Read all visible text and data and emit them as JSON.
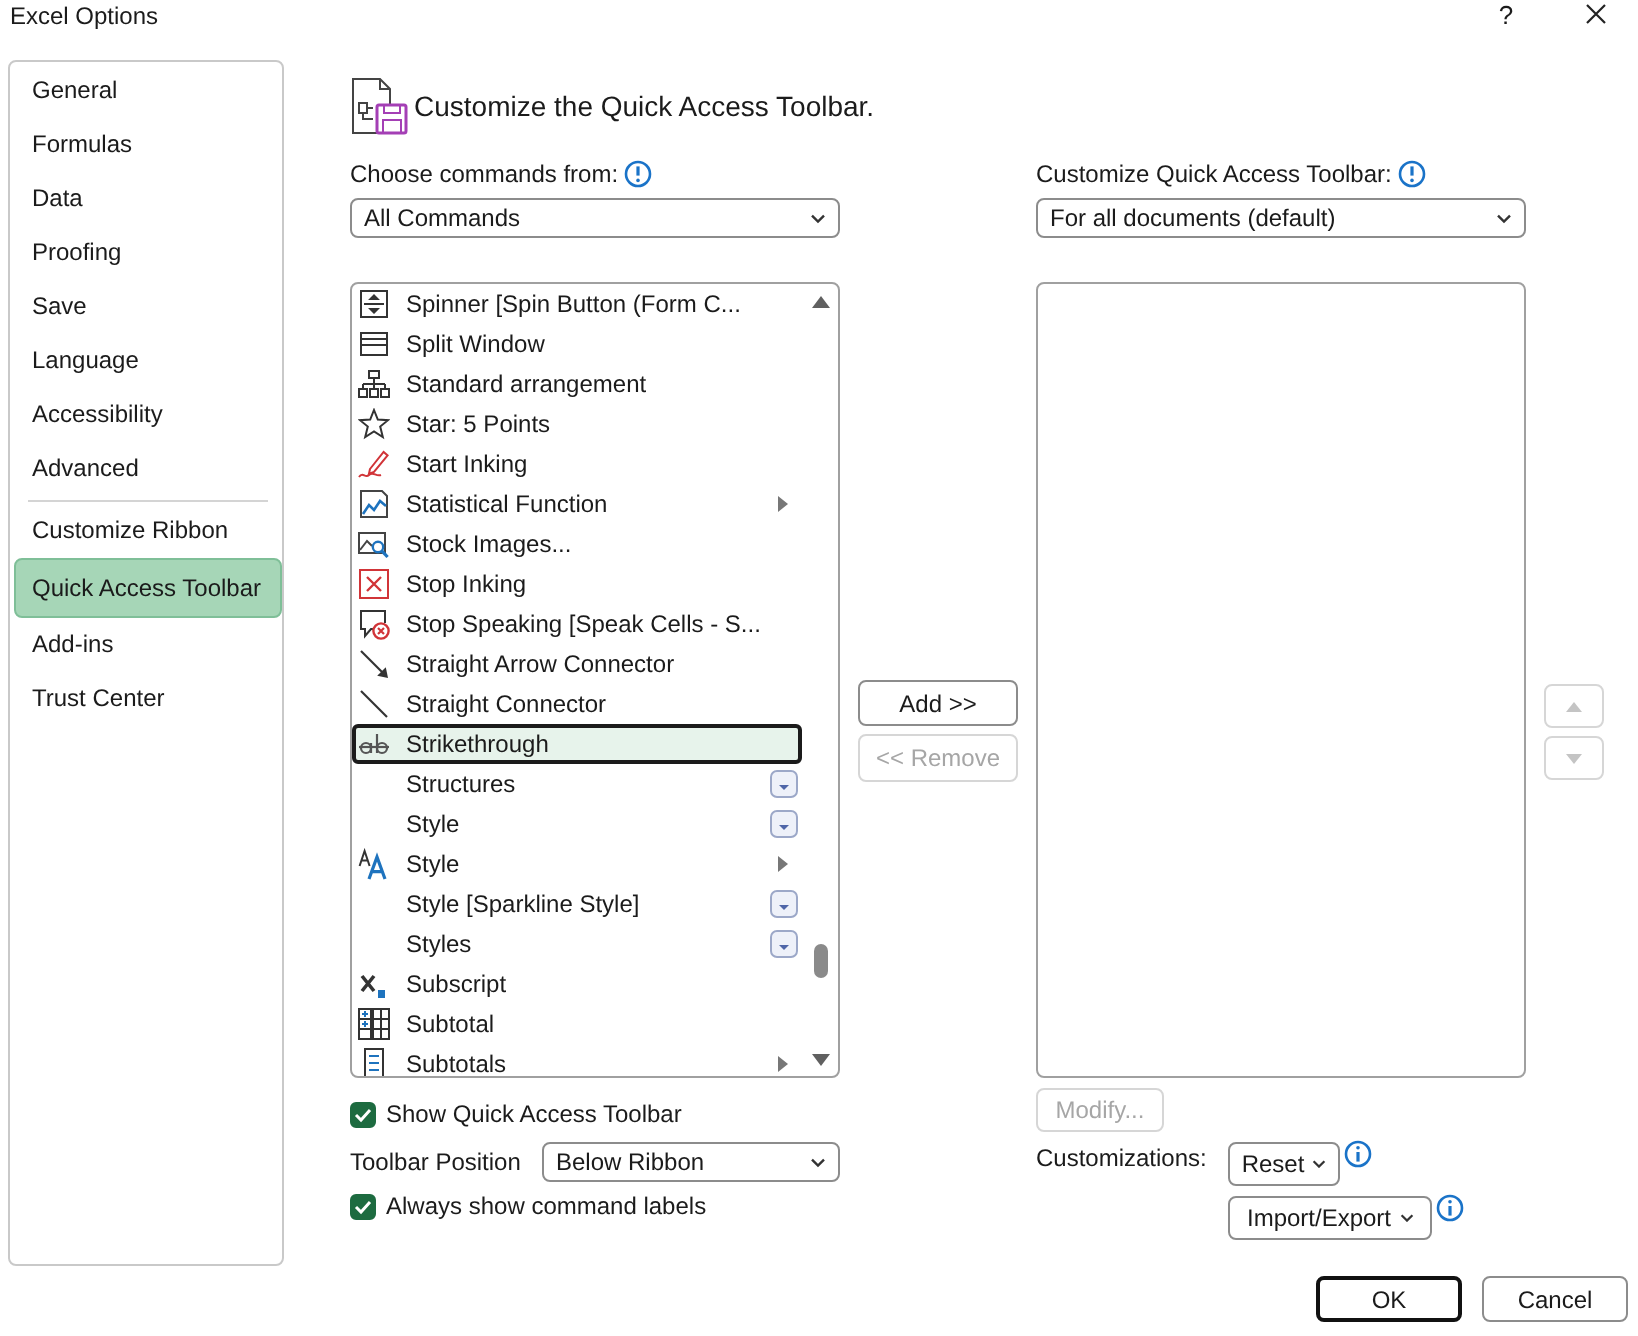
{
  "window": {
    "title": "Excel Options",
    "help": "?"
  },
  "sidebar": {
    "groups": [
      {
        "items": [
          {
            "label": "General",
            "selected": false
          },
          {
            "label": "Formulas",
            "selected": false
          },
          {
            "label": "Data",
            "selected": false
          },
          {
            "label": "Proofing",
            "selected": false
          },
          {
            "label": "Save",
            "selected": false
          },
          {
            "label": "Language",
            "selected": false
          },
          {
            "label": "Accessibility",
            "selected": false
          },
          {
            "label": "Advanced",
            "selected": false
          }
        ]
      },
      {
        "items": [
          {
            "label": "Customize Ribbon",
            "selected": false
          },
          {
            "label": "Quick Access Toolbar",
            "selected": true
          },
          {
            "label": "Add-ins",
            "selected": false
          },
          {
            "label": "Trust Center",
            "selected": false
          }
        ]
      }
    ]
  },
  "page": {
    "title": "Customize the Quick Access Toolbar.",
    "commands_source": {
      "label": "Choose commands from:",
      "value": "All Commands"
    },
    "commands": [
      {
        "label": "Spinner [Spin Button (Form C...",
        "kind": "plain",
        "selected": false
      },
      {
        "label": "Split Window",
        "kind": "plain",
        "selected": false
      },
      {
        "label": "Standard arrangement",
        "kind": "plain",
        "selected": false
      },
      {
        "label": "Star: 5 Points",
        "kind": "plain",
        "selected": false
      },
      {
        "label": "Start Inking",
        "kind": "plain",
        "selected": false
      },
      {
        "label": "Statistical Function",
        "kind": "submenu",
        "selected": false
      },
      {
        "label": "Stock Images...",
        "kind": "plain",
        "selected": false
      },
      {
        "label": "Stop Inking",
        "kind": "plain",
        "selected": false
      },
      {
        "label": "Stop Speaking [Speak Cells - S...",
        "kind": "plain",
        "selected": false
      },
      {
        "label": "Straight Arrow Connector",
        "kind": "plain",
        "selected": false
      },
      {
        "label": "Straight Connector",
        "kind": "plain",
        "selected": false
      },
      {
        "label": "Strikethrough",
        "kind": "plain",
        "selected": true
      },
      {
        "label": "Structures",
        "kind": "gallery",
        "selected": false
      },
      {
        "label": "Style",
        "kind": "gallery",
        "selected": false
      },
      {
        "label": "Style",
        "kind": "submenu",
        "selected": false
      },
      {
        "label": "Style [Sparkline Style]",
        "kind": "gallery",
        "selected": false
      },
      {
        "label": "Styles",
        "kind": "gallery",
        "selected": false
      },
      {
        "label": "Subscript",
        "kind": "plain",
        "selected": false
      },
      {
        "label": "Subtotal",
        "kind": "plain",
        "selected": false
      },
      {
        "label": "Subtotals",
        "kind": "submenu",
        "selected": false
      }
    ],
    "add_button": {
      "label": "Add >>",
      "disabled": false
    },
    "remove_button": {
      "label": "<< Remove",
      "disabled": true
    },
    "toolbar_target": {
      "label": "Customize Quick Access Toolbar:",
      "value": "For all documents (default)"
    },
    "move_up_button": {
      "disabled": true
    },
    "move_down_button": {
      "disabled": true
    },
    "modify_button": {
      "label": "Modify...",
      "disabled": true
    },
    "show_toolbar": {
      "label": "Show Quick Access Toolbar",
      "checked": true
    },
    "toolbar_position": {
      "label": "Toolbar Position",
      "value": "Below Ribbon"
    },
    "show_labels": {
      "label": "Always show command labels",
      "checked": true
    },
    "customizations": {
      "label": "Customizations:",
      "reset_button": "Reset",
      "import_export_button": "Import/Export"
    }
  },
  "footer": {
    "buttons": [
      {
        "label": "OK",
        "default": true
      },
      {
        "label": "Cancel",
        "default": false
      }
    ]
  }
}
